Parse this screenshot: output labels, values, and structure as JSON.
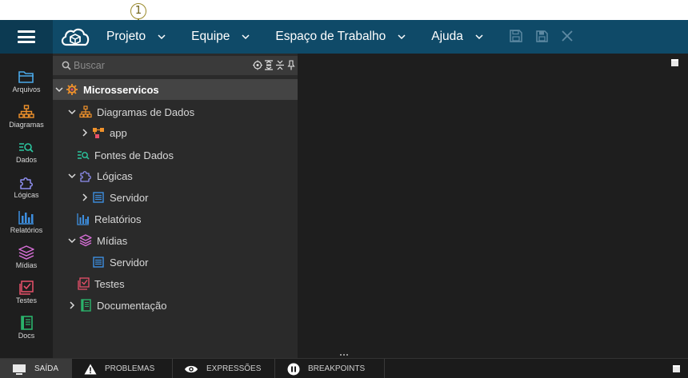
{
  "callout": {
    "number": "1"
  },
  "menu": [
    {
      "label": "Projeto"
    },
    {
      "label": "Equipe"
    },
    {
      "label": "Espaço de Trabalho"
    },
    {
      "label": "Ajuda"
    }
  ],
  "activity": [
    {
      "label": "Arquivos",
      "icon": "folder-icon",
      "color": "#4aa8e8"
    },
    {
      "label": "Diagramas",
      "icon": "diagram-icon",
      "color": "#f0922b"
    },
    {
      "label": "Dados",
      "icon": "data-search-icon",
      "color": "#2bc7a0"
    },
    {
      "label": "Lógicas",
      "icon": "puzzle-icon",
      "color": "#8f8ff0"
    },
    {
      "label": "Relatórios",
      "icon": "bar-chart-icon",
      "color": "#3d8fe0"
    },
    {
      "label": "Mídias",
      "icon": "layers-icon",
      "color": "#d86fd8"
    },
    {
      "label": "Testes",
      "icon": "test-check-icon",
      "color": "#e8506a"
    },
    {
      "label": "Docs",
      "icon": "book-icon",
      "color": "#2ab36b"
    }
  ],
  "search": {
    "placeholder": "Buscar"
  },
  "tree": {
    "root": "Microsservicos",
    "diagramas": "Diagramas de Dados",
    "app": "app",
    "fontes": "Fontes de Dados",
    "logicas": "Lógicas",
    "servidor1": "Servidor",
    "relatorios": "Relatórios",
    "midias": "Mídias",
    "servidor2": "Servidor",
    "testes": "Testes",
    "documentacao": "Documentação"
  },
  "bottom_tabs": [
    {
      "label": "SAÍDA",
      "icon": "monitor-icon"
    },
    {
      "label": "PROBLEMAS",
      "icon": "warning-icon"
    },
    {
      "label": "EXPRESSÕES",
      "icon": "eye-icon"
    },
    {
      "label": "BREAKPOINTS",
      "icon": "pause-icon"
    }
  ],
  "colors": {
    "topbar": "#0f4a68",
    "activity_bg": "#1e1e1e",
    "explorer_bg": "#2a2a2a",
    "accent_orange": "#f0922b"
  }
}
